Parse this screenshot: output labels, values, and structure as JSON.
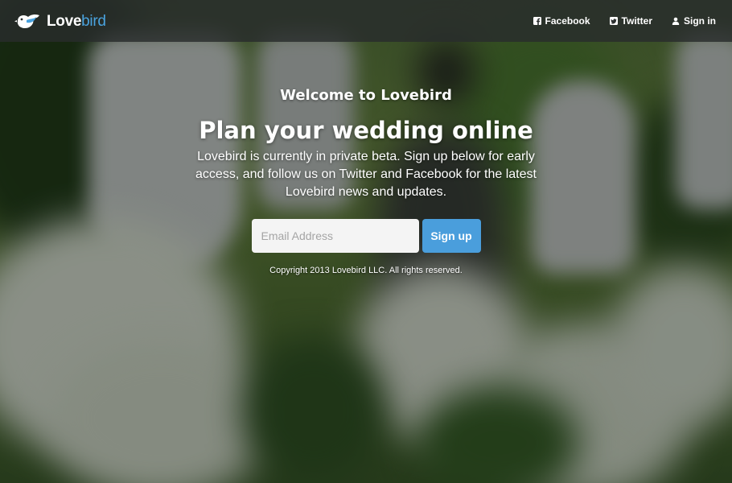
{
  "brand": {
    "name_part1": "Love",
    "name_part2": "bird",
    "logo_icon": "bird-icon",
    "accent_color": "#4aa3df"
  },
  "nav": {
    "items": [
      {
        "label": "Facebook",
        "icon": "facebook-icon"
      },
      {
        "label": "Twitter",
        "icon": "twitter-icon"
      },
      {
        "label": "Sign in",
        "icon": "user-icon"
      }
    ]
  },
  "hero": {
    "eyebrow": "Welcome to Lovebird",
    "headline": "Plan your wedding online",
    "lead": "Lovebird is currently in private beta. Sign up below for early access, and follow us on Twitter and Facebook for the latest Lovebird news and updates."
  },
  "signup": {
    "email_placeholder": "Email Address",
    "email_value": "",
    "button_label": "Sign up",
    "button_color": "#4a9edc"
  },
  "footer": {
    "copyright": "Copyright 2013 Lovebird LLC. All rights reserved."
  }
}
